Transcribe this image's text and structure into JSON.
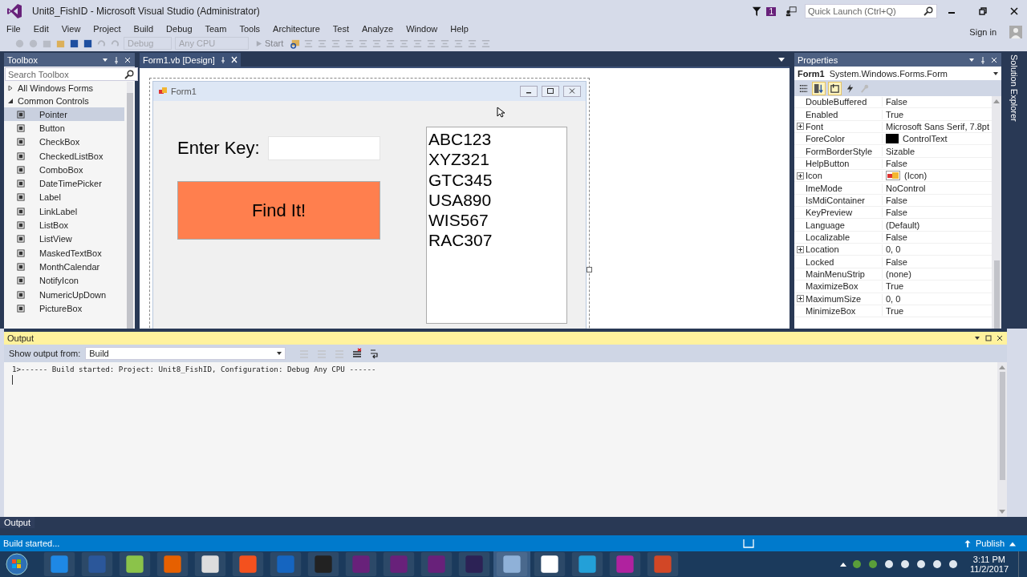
{
  "window": {
    "title": "Unit8_FishID - Microsoft Visual Studio (Administrator)"
  },
  "notification_count": "1",
  "quick_launch": {
    "placeholder": "Quick Launch (Ctrl+Q)"
  },
  "sign_in": "Sign in",
  "menu": [
    "File",
    "Edit",
    "View",
    "Project",
    "Build",
    "Debug",
    "Team",
    "Tools",
    "Architecture",
    "Test",
    "Analyze",
    "Window",
    "Help"
  ],
  "toolbar": {
    "configuration": "Debug",
    "platform": "Any CPU",
    "start": "Start"
  },
  "toolbox": {
    "title": "Toolbox",
    "search": {
      "placeholder": "Search Toolbox"
    },
    "groups": [
      {
        "label": "All Windows Forms",
        "expanded": false
      },
      {
        "label": "Common Controls",
        "expanded": true,
        "children": [
          {
            "label": "Pointer",
            "selected": true
          },
          {
            "label": "Button",
            "selected": false
          },
          {
            "label": "CheckBox",
            "selected": false
          },
          {
            "label": "CheckedListBox",
            "selected": false
          },
          {
            "label": "ComboBox",
            "selected": false
          },
          {
            "label": "DateTimePicker",
            "selected": false
          },
          {
            "label": "Label",
            "selected": false
          },
          {
            "label": "LinkLabel",
            "selected": false
          },
          {
            "label": "ListBox",
            "selected": false
          },
          {
            "label": "ListView",
            "selected": false
          },
          {
            "label": "MaskedTextBox",
            "selected": false
          },
          {
            "label": "MonthCalendar",
            "selected": false
          },
          {
            "label": "NotifyIcon",
            "selected": false
          },
          {
            "label": "NumericUpDown",
            "selected": false
          },
          {
            "label": "PictureBox",
            "selected": false
          }
        ]
      }
    ]
  },
  "document_tab": {
    "label": "Form1.vb [Design]"
  },
  "form": {
    "title": "Form1",
    "key_label": "Enter Key:",
    "button": "Find It!",
    "list_items": [
      "ABC123",
      "XYZ321",
      "GTC345",
      "USA890",
      "WIS567",
      "RAC307"
    ]
  },
  "properties": {
    "title": "Properties",
    "object": "Form1",
    "type": "System.Windows.Forms.Form",
    "rows": [
      {
        "name": "DoubleBuffered",
        "value": "False",
        "expandable": false,
        "kind": "text"
      },
      {
        "name": "Enabled",
        "value": "True",
        "expandable": false,
        "kind": "text"
      },
      {
        "name": "Font",
        "value": "Microsoft Sans Serif, 7.8pt",
        "expandable": true,
        "kind": "text"
      },
      {
        "name": "ForeColor",
        "value": "ControlText",
        "expandable": false,
        "kind": "color",
        "color": "#000000"
      },
      {
        "name": "FormBorderStyle",
        "value": "Sizable",
        "expandable": false,
        "kind": "text"
      },
      {
        "name": "HelpButton",
        "value": "False",
        "expandable": false,
        "kind": "text"
      },
      {
        "name": "Icon",
        "value": "(Icon)",
        "expandable": true,
        "kind": "icon"
      },
      {
        "name": "ImeMode",
        "value": "NoControl",
        "expandable": false,
        "kind": "text"
      },
      {
        "name": "IsMdiContainer",
        "value": "False",
        "expandable": false,
        "kind": "text"
      },
      {
        "name": "KeyPreview",
        "value": "False",
        "expandable": false,
        "kind": "text"
      },
      {
        "name": "Language",
        "value": "(Default)",
        "expandable": false,
        "kind": "text"
      },
      {
        "name": "Localizable",
        "value": "False",
        "expandable": false,
        "kind": "text"
      },
      {
        "name": "Location",
        "value": "0, 0",
        "expandable": true,
        "kind": "text"
      },
      {
        "name": "Locked",
        "value": "False",
        "expandable": false,
        "kind": "text"
      },
      {
        "name": "MainMenuStrip",
        "value": "(none)",
        "expandable": false,
        "kind": "text"
      },
      {
        "name": "MaximizeBox",
        "value": "True",
        "expandable": false,
        "kind": "text"
      },
      {
        "name": "MaximumSize",
        "value": "0, 0",
        "expandable": true,
        "kind": "text"
      },
      {
        "name": "MinimizeBox",
        "value": "True",
        "expandable": false,
        "kind": "text"
      }
    ]
  },
  "solution_explorer_tab": "Solution Explorer",
  "output": {
    "title": "Output",
    "source_label": "Show output from:",
    "source": "Build",
    "lines": [
      "1>------ Build started: Project: Unit8_FishID, Configuration: Debug Any CPU ------"
    ]
  },
  "bottom_tab": "Output",
  "status": {
    "text": "Build started...",
    "publish": "Publish"
  },
  "taskbar": {
    "time": "3:11 PM",
    "date": "11/2/2017"
  }
}
